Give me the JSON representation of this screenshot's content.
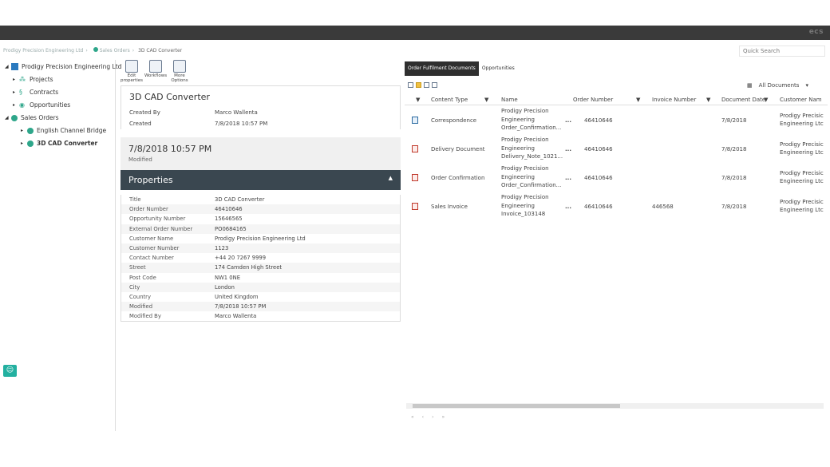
{
  "header": {
    "brand": "ecs"
  },
  "breadcrumb": [
    "Prodigy Precision Engineering Ltd",
    "Sales Orders",
    "3D CAD Converter"
  ],
  "search": {
    "placeholder": "Quick Search"
  },
  "tree": {
    "root": "Prodigy Precision Engineering Ltd",
    "items": [
      "Projects",
      "Contracts",
      "Opportunities",
      "Sales Orders"
    ],
    "children": [
      "English Channel Bridge",
      "3D CAD Converter"
    ]
  },
  "toolbar": {
    "edit_label": "Edit properties",
    "workflows_label": "Workflows",
    "more_label": "More Options"
  },
  "document": {
    "title": "3D CAD Converter",
    "created_by_label": "Created By",
    "created_by": "Marco Wallenta",
    "created_label": "Created",
    "created": "7/8/2018 10:57 PM",
    "modified_big": "7/8/2018 10:57 PM",
    "modified_label": "Modified"
  },
  "properties": {
    "heading": "Properties",
    "rows": [
      {
        "k": "Title",
        "v": "3D CAD Converter"
      },
      {
        "k": "Order Number",
        "v": "46410646"
      },
      {
        "k": "Opportunity Number",
        "v": "15646565"
      },
      {
        "k": "External Order Number",
        "v": "PO0684165"
      },
      {
        "k": "Customer Name",
        "v": "Prodigy Precision Engineering Ltd"
      },
      {
        "k": "Customer Number",
        "v": "1123"
      },
      {
        "k": "Contact Number",
        "v": "+44 20 7267 9999"
      },
      {
        "k": "Street",
        "v": "174 Camden High Street"
      },
      {
        "k": "Post Code",
        "v": "NW1 0NE"
      },
      {
        "k": "City",
        "v": "London"
      },
      {
        "k": "Country",
        "v": "United Kingdom"
      },
      {
        "k": "Modified",
        "v": "7/8/2018 10:57 PM"
      },
      {
        "k": "Modified By",
        "v": "Marco Wallenta"
      }
    ]
  },
  "tabs": [
    "Order Fulfilment Documents",
    "Opportunities"
  ],
  "view": {
    "label": "All Documents"
  },
  "grid": {
    "headers": [
      "Content Type",
      "Name",
      "Order Number",
      "Invoice Number",
      "Document Date",
      "Customer Nam"
    ],
    "rows": [
      {
        "type": "Correspondence",
        "name1": "Prodigy Precision",
        "name2": "Engineering",
        "name3": "Order_Confirmation...",
        "order": "46410646",
        "invoice": "",
        "date": "7/8/2018",
        "cust1": "Prodigy Precisic",
        "cust2": "Engineering Ltc",
        "icon": "word-doc-icon"
      },
      {
        "type": "Delivery Document",
        "name1": "Prodigy Precision",
        "name2": "Engineering",
        "name3": "Delivery_Note_1021...",
        "order": "46410646",
        "invoice": "",
        "date": "7/8/2018",
        "cust1": "Prodigy Precisic",
        "cust2": "Engineering Ltc",
        "icon": "pdf-icon"
      },
      {
        "type": "Order Confirmation",
        "name1": "Prodigy Precision",
        "name2": "Engineering",
        "name3": "Order_Confirmation...",
        "order": "46410646",
        "invoice": "",
        "date": "7/8/2018",
        "cust1": "Prodigy Precisic",
        "cust2": "Engineering Ltc",
        "icon": "pdf-icon"
      },
      {
        "type": "Sales Invoice",
        "name1": "Prodigy Precision",
        "name2": "Engineering",
        "name3": "Invoice_103148",
        "order": "46410646",
        "invoice": "446568",
        "date": "7/8/2018",
        "cust1": "Prodigy Precisic",
        "cust2": "Engineering Ltc",
        "icon": "pdf-icon"
      }
    ],
    "ellipsis": "...",
    "pager": [
      "«",
      "‹",
      "›",
      "»"
    ]
  }
}
